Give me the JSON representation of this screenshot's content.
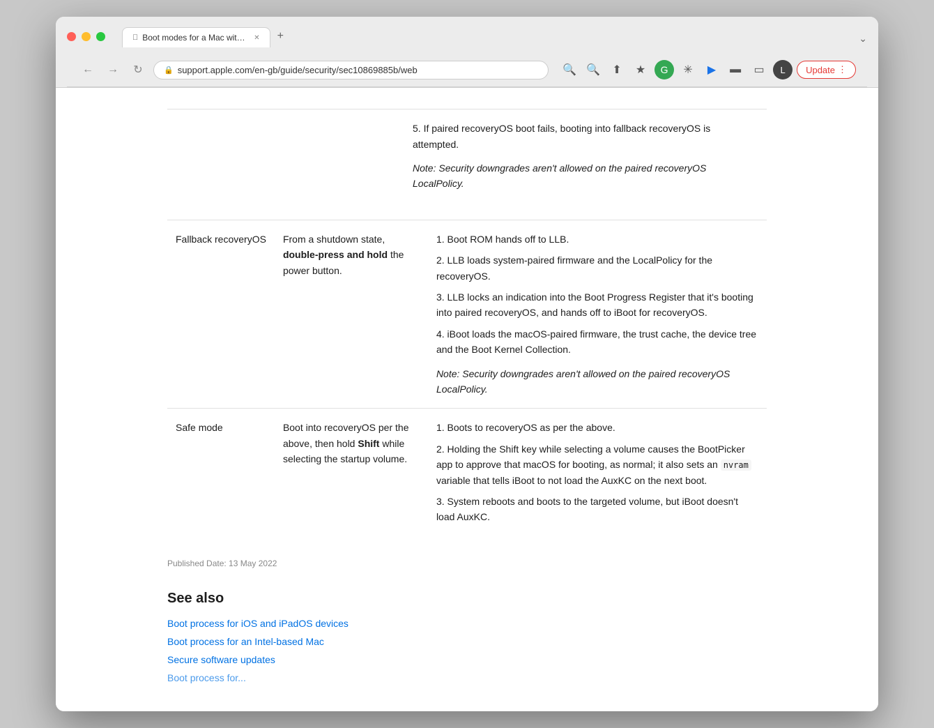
{
  "browser": {
    "tab_title": "Boot modes for a Mac with Ap",
    "url": "support.apple.com/en-gb/guide/security/sec10869885b/web",
    "new_tab_label": "+",
    "nav": {
      "back": "‹",
      "forward": "›",
      "refresh": "↻"
    },
    "update_button_label": "Update",
    "profile_label": "L",
    "chevron_down": "⌄"
  },
  "content": {
    "table_rows": [
      {
        "col1": "Fallback recoveryOS",
        "col2_pre": "From a shutdown state, ",
        "col2_bold": "double-press and hold",
        "col2_post": " the power button.",
        "col3_items": [
          "1. Boot ROM hands off to LLB.",
          "2. LLB loads system-paired firmware and the LocalPolicy for the recoveryOS.",
          "3. LLB locks an indication into the Boot Progress Register that it's booting into paired recoveryOS, and hands off to iBoot for recoveryOS.",
          "4. iBoot loads the macOS-paired firmware, the trust cache, the device tree and the Boot Kernel Collection."
        ],
        "col3_note": "Note: Security downgrades aren't allowed on the paired recoveryOS LocalPolicy."
      },
      {
        "col1": "Safe mode",
        "col2_pre": "Boot into recoveryOS per the above, then hold ",
        "col2_bold": "Shift",
        "col2_post": " while selecting the startup volume.",
        "col3_items": [
          "1. Boots to recoveryOS as per the above.",
          "2. Holding the Shift key while selecting a volume causes the BootPicker app to approve that macOS for booting, as normal; it also sets an nvram variable that tells iBoot to not load the AuxKC on the next boot.",
          "3. System reboots and boots to the targeted volume, but iBoot doesn't load AuxKC."
        ],
        "col3_note": ""
      }
    ],
    "first_section_note": "Note: Security downgrades aren't allowed on the paired recoveryOS LocalPolicy.",
    "first_section_items": [
      "5. If paired recoveryOS boot fails, booting into fallback recoveryOS is attempted."
    ],
    "published_date": "Published Date: 13 May 2022",
    "see_also_heading": "See also",
    "see_also_links": [
      "Boot process for iOS and iPadOS devices",
      "Boot process for an Intel-based Mac",
      "Secure software updates"
    ],
    "partial_link_text": "Boot process for..."
  }
}
